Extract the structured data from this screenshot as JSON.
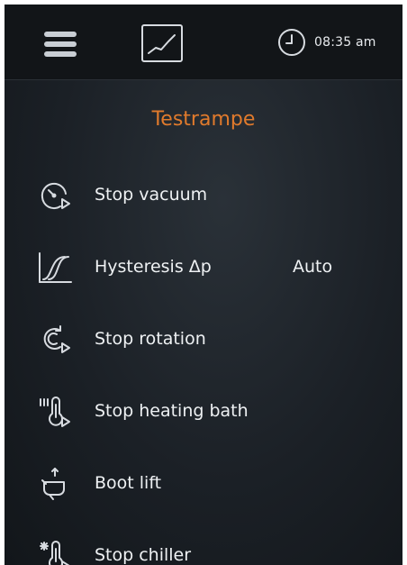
{
  "topbar": {
    "menu_icon": "hamburger-icon",
    "chart_icon": "chart-icon",
    "clock_icon": "clock-icon",
    "time": "08:35 am"
  },
  "title": "Testrampe",
  "colors": {
    "accent": "#e07a2c",
    "background": "#1b2026",
    "topbar": "#121518",
    "text": "#eef1f3"
  },
  "items": [
    {
      "label": "Stop vacuum",
      "icon": "vacuum-icon"
    },
    {
      "label": "Hysteresis Δp",
      "value": "Auto",
      "icon": "hysteresis-icon"
    },
    {
      "label": "Stop rotation",
      "icon": "rotation-icon"
    },
    {
      "label": "Stop heating bath",
      "icon": "heating-bath-icon"
    },
    {
      "label": "Boot lift",
      "icon": "lift-icon"
    },
    {
      "label": "Stop chiller",
      "icon": "chiller-icon"
    }
  ]
}
